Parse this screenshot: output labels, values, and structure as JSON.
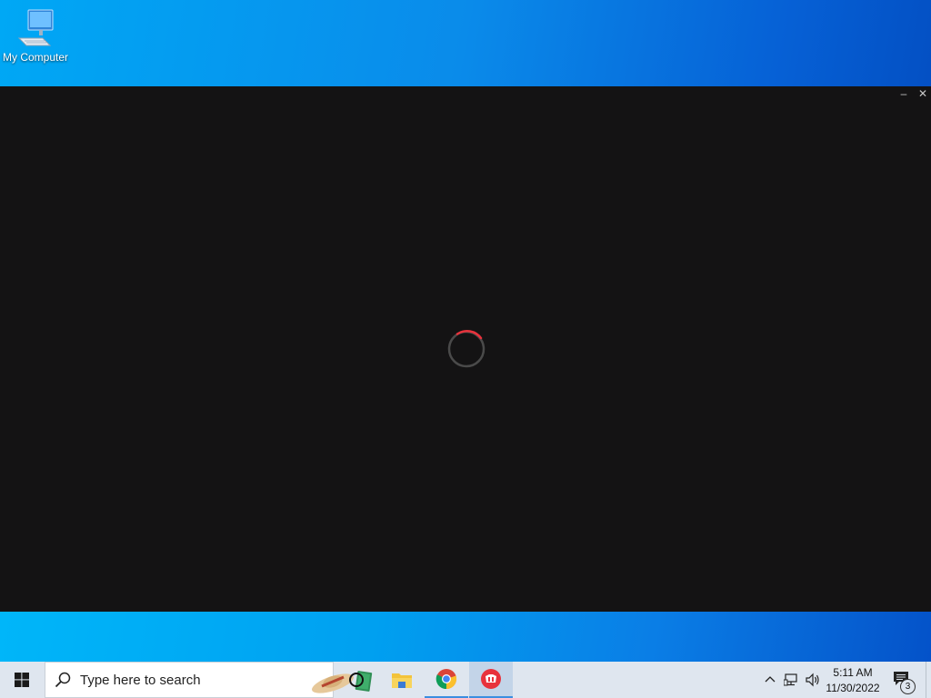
{
  "desktop": {
    "icons": [
      {
        "label": "My Computer",
        "icon": "computer-icon"
      }
    ]
  },
  "window": {
    "minimize_glyph": "–",
    "close_glyph": "✕",
    "loading": true,
    "spinner_accent": "#e8323c"
  },
  "taskbar": {
    "start_icon": "windows-logo-icon",
    "search": {
      "placeholder": "Type here to search"
    },
    "pinned": [
      {
        "name": "cortana",
        "icon": "cortana-circle-icon"
      },
      {
        "name": "file-explorer",
        "icon": "folder-icon"
      },
      {
        "name": "google-chrome",
        "icon": "chrome-icon",
        "running": true
      },
      {
        "name": "app",
        "icon": "red-app-icon",
        "running": true,
        "active": true
      }
    ],
    "tray": {
      "icons": [
        "chevron-up-icon",
        "network-icon",
        "volume-icon"
      ],
      "time": "5:11 AM",
      "date": "11/30/2022",
      "notification_count": "3"
    }
  },
  "colors": {
    "taskbar_bg": "#dfe6ef",
    "window_bg": "#141314",
    "desktop_accent": "#0a7ee6"
  }
}
